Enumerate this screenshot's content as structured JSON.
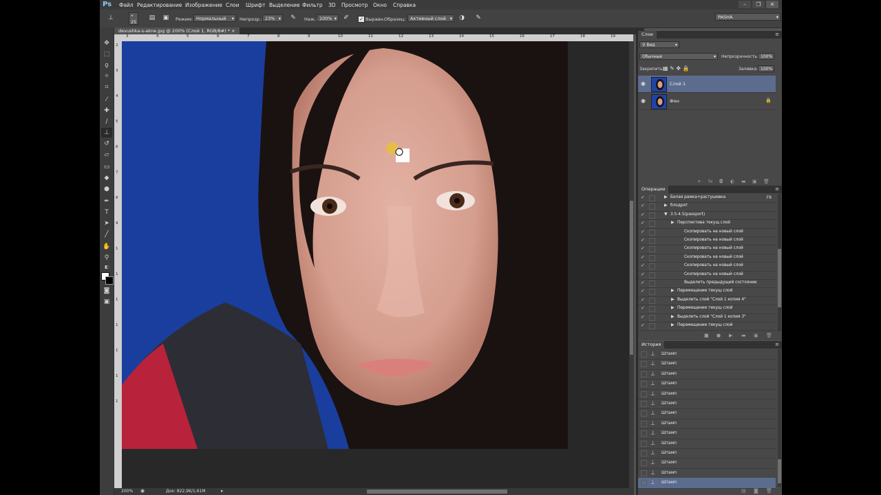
{
  "app": {
    "logo": "Ps"
  },
  "menu": [
    "Файл",
    "Редактирование",
    "Изображение",
    "Слои",
    "Шрифт",
    "Выделение",
    "Фильтр",
    "3D",
    "Просмотр",
    "Окно",
    "Справка"
  ],
  "window_buttons": {
    "minimize": "–",
    "restore": "❐",
    "close": "✕"
  },
  "options": {
    "brush_size": "25",
    "mode_label": "Режим:",
    "mode_value": "Нормальный",
    "opacity_label": "Непрозр.:",
    "opacity_value": "23%",
    "flow_label": "Наж.:",
    "flow_value": "100%",
    "aligned_label": "Выравн.",
    "sample_label": "Образец:",
    "sample_value": "Активный слой",
    "workspace": "PASHA"
  },
  "document": {
    "tab_title": "devushka-s-akne.jpg @ 200% (Слой 1, RGB/8#) *",
    "ruler_h": [
      "3",
      "4",
      "5",
      "6",
      "7",
      "8",
      "9",
      "10",
      "11",
      "12",
      "13",
      "14",
      "15",
      "16",
      "17",
      "18",
      "19"
    ],
    "ruler_v": [
      "2",
      "3",
      "4",
      "5",
      "6",
      "7",
      "8",
      "9",
      "1",
      "1",
      "1",
      "1",
      "1",
      "1",
      "1"
    ],
    "status_zoom": "200%",
    "status_doc": "Док: 822,9K/1,61M"
  },
  "layers_panel": {
    "title": "Слои",
    "filter": "Вид",
    "blend_mode": "Обычные",
    "opacity_label": "Непрозрачность:",
    "opacity_value": "100%",
    "lock_label": "Закрепить:",
    "fill_label": "Заливка:",
    "fill_value": "100%",
    "layers": [
      {
        "name": "Слой 1",
        "selected": true
      },
      {
        "name": "Фон",
        "selected": false
      }
    ]
  },
  "actions_panel": {
    "title": "Операции",
    "rows": [
      {
        "label": "Белая рамка+растушевка",
        "key": "F8",
        "indent": 0,
        "tri": "▶"
      },
      {
        "label": "блодрят",
        "key": "",
        "indent": 0,
        "tri": "▶"
      },
      {
        "label": "3.5-4.5(passport)",
        "key": "",
        "indent": 0,
        "tri": "▼"
      },
      {
        "label": "Перспектива текущ слой",
        "key": "",
        "indent": 1,
        "tri": "▶"
      },
      {
        "label": "Скопировать на новый слой",
        "key": "",
        "indent": 2,
        "tri": ""
      },
      {
        "label": "Скопировать на новый слой",
        "key": "",
        "indent": 2,
        "tri": ""
      },
      {
        "label": "Скопировать на новый слой",
        "key": "",
        "indent": 2,
        "tri": ""
      },
      {
        "label": "Скопировать на новый слой",
        "key": "",
        "indent": 2,
        "tri": ""
      },
      {
        "label": "Скопировать на новый слой",
        "key": "",
        "indent": 2,
        "tri": ""
      },
      {
        "label": "Скопировать на новый слой",
        "key": "",
        "indent": 2,
        "tri": ""
      },
      {
        "label": "Выделить предыдущий состояние",
        "key": "",
        "indent": 2,
        "tri": ""
      },
      {
        "label": "Перемещение текущ слой",
        "key": "",
        "indent": 1,
        "tri": "▶"
      },
      {
        "label": "Выделить слой \"Слой 1 копия 4\"",
        "key": "",
        "indent": 1,
        "tri": "▶"
      },
      {
        "label": "Перемещение текущ слой",
        "key": "",
        "indent": 1,
        "tri": "▶"
      },
      {
        "label": "Выделить слой \"Слой 1 копия 3\"",
        "key": "",
        "indent": 1,
        "tri": "▶"
      },
      {
        "label": "Перемещение текущ слой",
        "key": "",
        "indent": 1,
        "tri": "▶"
      }
    ]
  },
  "history_panel": {
    "title": "История",
    "items": [
      "Штамп",
      "Штамп",
      "Штамп",
      "Штамп",
      "Штамп",
      "Штамп",
      "Штамп",
      "Штамп",
      "Штамп",
      "Штамп",
      "Штамп",
      "Штамп",
      "Штамп",
      "Штамп"
    ],
    "selected_index": 13
  }
}
